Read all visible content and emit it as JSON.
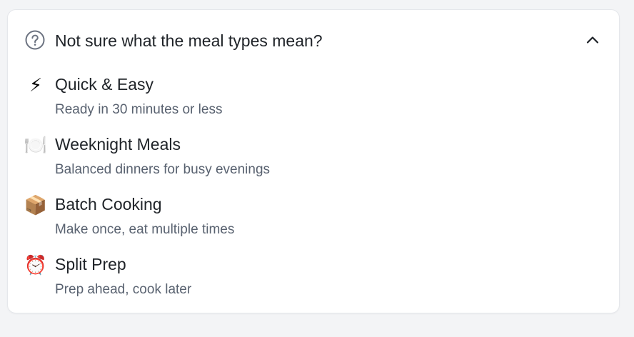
{
  "help_panel": {
    "question": "Not sure what the meal types mean?",
    "expanded": true,
    "header_icon": "question-circle-icon",
    "toggle_icon": "chevron-up-icon",
    "items": [
      {
        "title": "Quick & Easy",
        "description": "Ready in 30 minutes or less",
        "icon": "⚡",
        "icon_name": "lightning-icon"
      },
      {
        "title": "Weeknight Meals",
        "description": "Balanced dinners for busy evenings",
        "icon": "🍽️",
        "icon_name": "plate-icon"
      },
      {
        "title": "Batch Cooking",
        "description": "Make once, eat multiple times",
        "icon": "📦",
        "icon_name": "package-icon"
      },
      {
        "title": "Split Prep",
        "description": "Prep ahead, cook later",
        "icon": "⏰",
        "icon_name": "alarm-clock-icon"
      }
    ]
  },
  "colors": {
    "background": "#f3f4f6",
    "card": "#ffffff",
    "border": "#e5e7eb",
    "title_text": "#1f2328",
    "description_text": "#596270",
    "icon_gray": "#6b7280"
  }
}
